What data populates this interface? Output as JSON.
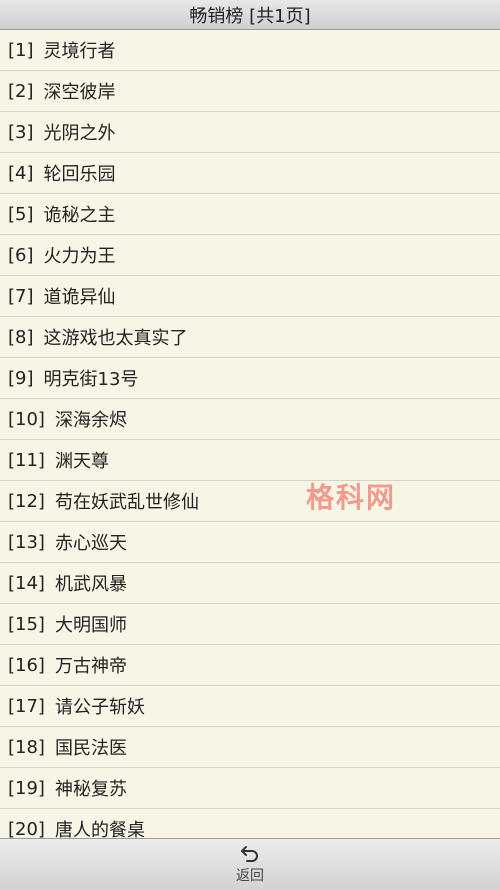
{
  "header": {
    "title": "畅销榜 [共1页]"
  },
  "list": {
    "items": [
      {
        "rank": "[1]",
        "title": "灵境行者"
      },
      {
        "rank": "[2]",
        "title": "深空彼岸"
      },
      {
        "rank": "[3]",
        "title": "光阴之外"
      },
      {
        "rank": "[4]",
        "title": "轮回乐园"
      },
      {
        "rank": "[5]",
        "title": "诡秘之主"
      },
      {
        "rank": "[6]",
        "title": "火力为王"
      },
      {
        "rank": "[7]",
        "title": "道诡异仙"
      },
      {
        "rank": "[8]",
        "title": "这游戏也太真实了"
      },
      {
        "rank": "[9]",
        "title": "明克街13号"
      },
      {
        "rank": "[10]",
        "title": "深海余烬"
      },
      {
        "rank": "[11]",
        "title": "渊天尊"
      },
      {
        "rank": "[12]",
        "title": "苟在妖武乱世修仙"
      },
      {
        "rank": "[13]",
        "title": "赤心巡天"
      },
      {
        "rank": "[14]",
        "title": "机武风暴"
      },
      {
        "rank": "[15]",
        "title": "大明国师"
      },
      {
        "rank": "[16]",
        "title": "万古神帝"
      },
      {
        "rank": "[17]",
        "title": "请公子斩妖"
      },
      {
        "rank": "[18]",
        "title": "国民法医"
      },
      {
        "rank": "[19]",
        "title": "神秘复苏"
      },
      {
        "rank": "[20]",
        "title": "唐人的餐桌"
      }
    ]
  },
  "watermark": {
    "text": "格科网",
    "color": "#eb5046"
  },
  "footer": {
    "back_label": "返回",
    "back_icon": "back-arrow-icon"
  }
}
